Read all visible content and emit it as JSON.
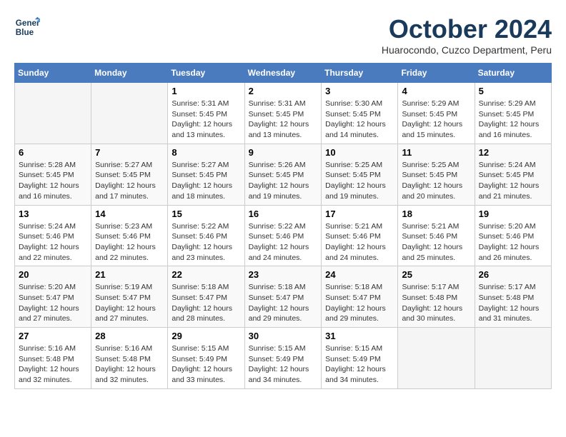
{
  "header": {
    "logo_line1": "General",
    "logo_line2": "Blue",
    "month": "October 2024",
    "location": "Huarocondo, Cuzco Department, Peru"
  },
  "days_of_week": [
    "Sunday",
    "Monday",
    "Tuesday",
    "Wednesday",
    "Thursday",
    "Friday",
    "Saturday"
  ],
  "weeks": [
    [
      {
        "day": "",
        "sunrise": "",
        "sunset": "",
        "daylight": "",
        "empty": true
      },
      {
        "day": "",
        "sunrise": "",
        "sunset": "",
        "daylight": "",
        "empty": true
      },
      {
        "day": "1",
        "sunrise": "Sunrise: 5:31 AM",
        "sunset": "Sunset: 5:45 PM",
        "daylight": "Daylight: 12 hours and 13 minutes.",
        "empty": false
      },
      {
        "day": "2",
        "sunrise": "Sunrise: 5:31 AM",
        "sunset": "Sunset: 5:45 PM",
        "daylight": "Daylight: 12 hours and 13 minutes.",
        "empty": false
      },
      {
        "day": "3",
        "sunrise": "Sunrise: 5:30 AM",
        "sunset": "Sunset: 5:45 PM",
        "daylight": "Daylight: 12 hours and 14 minutes.",
        "empty": false
      },
      {
        "day": "4",
        "sunrise": "Sunrise: 5:29 AM",
        "sunset": "Sunset: 5:45 PM",
        "daylight": "Daylight: 12 hours and 15 minutes.",
        "empty": false
      },
      {
        "day": "5",
        "sunrise": "Sunrise: 5:29 AM",
        "sunset": "Sunset: 5:45 PM",
        "daylight": "Daylight: 12 hours and 16 minutes.",
        "empty": false
      }
    ],
    [
      {
        "day": "6",
        "sunrise": "Sunrise: 5:28 AM",
        "sunset": "Sunset: 5:45 PM",
        "daylight": "Daylight: 12 hours and 16 minutes.",
        "empty": false
      },
      {
        "day": "7",
        "sunrise": "Sunrise: 5:27 AM",
        "sunset": "Sunset: 5:45 PM",
        "daylight": "Daylight: 12 hours and 17 minutes.",
        "empty": false
      },
      {
        "day": "8",
        "sunrise": "Sunrise: 5:27 AM",
        "sunset": "Sunset: 5:45 PM",
        "daylight": "Daylight: 12 hours and 18 minutes.",
        "empty": false
      },
      {
        "day": "9",
        "sunrise": "Sunrise: 5:26 AM",
        "sunset": "Sunset: 5:45 PM",
        "daylight": "Daylight: 12 hours and 19 minutes.",
        "empty": false
      },
      {
        "day": "10",
        "sunrise": "Sunrise: 5:25 AM",
        "sunset": "Sunset: 5:45 PM",
        "daylight": "Daylight: 12 hours and 19 minutes.",
        "empty": false
      },
      {
        "day": "11",
        "sunrise": "Sunrise: 5:25 AM",
        "sunset": "Sunset: 5:45 PM",
        "daylight": "Daylight: 12 hours and 20 minutes.",
        "empty": false
      },
      {
        "day": "12",
        "sunrise": "Sunrise: 5:24 AM",
        "sunset": "Sunset: 5:45 PM",
        "daylight": "Daylight: 12 hours and 21 minutes.",
        "empty": false
      }
    ],
    [
      {
        "day": "13",
        "sunrise": "Sunrise: 5:24 AM",
        "sunset": "Sunset: 5:46 PM",
        "daylight": "Daylight: 12 hours and 22 minutes.",
        "empty": false
      },
      {
        "day": "14",
        "sunrise": "Sunrise: 5:23 AM",
        "sunset": "Sunset: 5:46 PM",
        "daylight": "Daylight: 12 hours and 22 minutes.",
        "empty": false
      },
      {
        "day": "15",
        "sunrise": "Sunrise: 5:22 AM",
        "sunset": "Sunset: 5:46 PM",
        "daylight": "Daylight: 12 hours and 23 minutes.",
        "empty": false
      },
      {
        "day": "16",
        "sunrise": "Sunrise: 5:22 AM",
        "sunset": "Sunset: 5:46 PM",
        "daylight": "Daylight: 12 hours and 24 minutes.",
        "empty": false
      },
      {
        "day": "17",
        "sunrise": "Sunrise: 5:21 AM",
        "sunset": "Sunset: 5:46 PM",
        "daylight": "Daylight: 12 hours and 24 minutes.",
        "empty": false
      },
      {
        "day": "18",
        "sunrise": "Sunrise: 5:21 AM",
        "sunset": "Sunset: 5:46 PM",
        "daylight": "Daylight: 12 hours and 25 minutes.",
        "empty": false
      },
      {
        "day": "19",
        "sunrise": "Sunrise: 5:20 AM",
        "sunset": "Sunset: 5:46 PM",
        "daylight": "Daylight: 12 hours and 26 minutes.",
        "empty": false
      }
    ],
    [
      {
        "day": "20",
        "sunrise": "Sunrise: 5:20 AM",
        "sunset": "Sunset: 5:47 PM",
        "daylight": "Daylight: 12 hours and 27 minutes.",
        "empty": false
      },
      {
        "day": "21",
        "sunrise": "Sunrise: 5:19 AM",
        "sunset": "Sunset: 5:47 PM",
        "daylight": "Daylight: 12 hours and 27 minutes.",
        "empty": false
      },
      {
        "day": "22",
        "sunrise": "Sunrise: 5:18 AM",
        "sunset": "Sunset: 5:47 PM",
        "daylight": "Daylight: 12 hours and 28 minutes.",
        "empty": false
      },
      {
        "day": "23",
        "sunrise": "Sunrise: 5:18 AM",
        "sunset": "Sunset: 5:47 PM",
        "daylight": "Daylight: 12 hours and 29 minutes.",
        "empty": false
      },
      {
        "day": "24",
        "sunrise": "Sunrise: 5:18 AM",
        "sunset": "Sunset: 5:47 PM",
        "daylight": "Daylight: 12 hours and 29 minutes.",
        "empty": false
      },
      {
        "day": "25",
        "sunrise": "Sunrise: 5:17 AM",
        "sunset": "Sunset: 5:48 PM",
        "daylight": "Daylight: 12 hours and 30 minutes.",
        "empty": false
      },
      {
        "day": "26",
        "sunrise": "Sunrise: 5:17 AM",
        "sunset": "Sunset: 5:48 PM",
        "daylight": "Daylight: 12 hours and 31 minutes.",
        "empty": false
      }
    ],
    [
      {
        "day": "27",
        "sunrise": "Sunrise: 5:16 AM",
        "sunset": "Sunset: 5:48 PM",
        "daylight": "Daylight: 12 hours and 32 minutes.",
        "empty": false
      },
      {
        "day": "28",
        "sunrise": "Sunrise: 5:16 AM",
        "sunset": "Sunset: 5:48 PM",
        "daylight": "Daylight: 12 hours and 32 minutes.",
        "empty": false
      },
      {
        "day": "29",
        "sunrise": "Sunrise: 5:15 AM",
        "sunset": "Sunset: 5:49 PM",
        "daylight": "Daylight: 12 hours and 33 minutes.",
        "empty": false
      },
      {
        "day": "30",
        "sunrise": "Sunrise: 5:15 AM",
        "sunset": "Sunset: 5:49 PM",
        "daylight": "Daylight: 12 hours and 34 minutes.",
        "empty": false
      },
      {
        "day": "31",
        "sunrise": "Sunrise: 5:15 AM",
        "sunset": "Sunset: 5:49 PM",
        "daylight": "Daylight: 12 hours and 34 minutes.",
        "empty": false
      },
      {
        "day": "",
        "sunrise": "",
        "sunset": "",
        "daylight": "",
        "empty": true
      },
      {
        "day": "",
        "sunrise": "",
        "sunset": "",
        "daylight": "",
        "empty": true
      }
    ]
  ]
}
